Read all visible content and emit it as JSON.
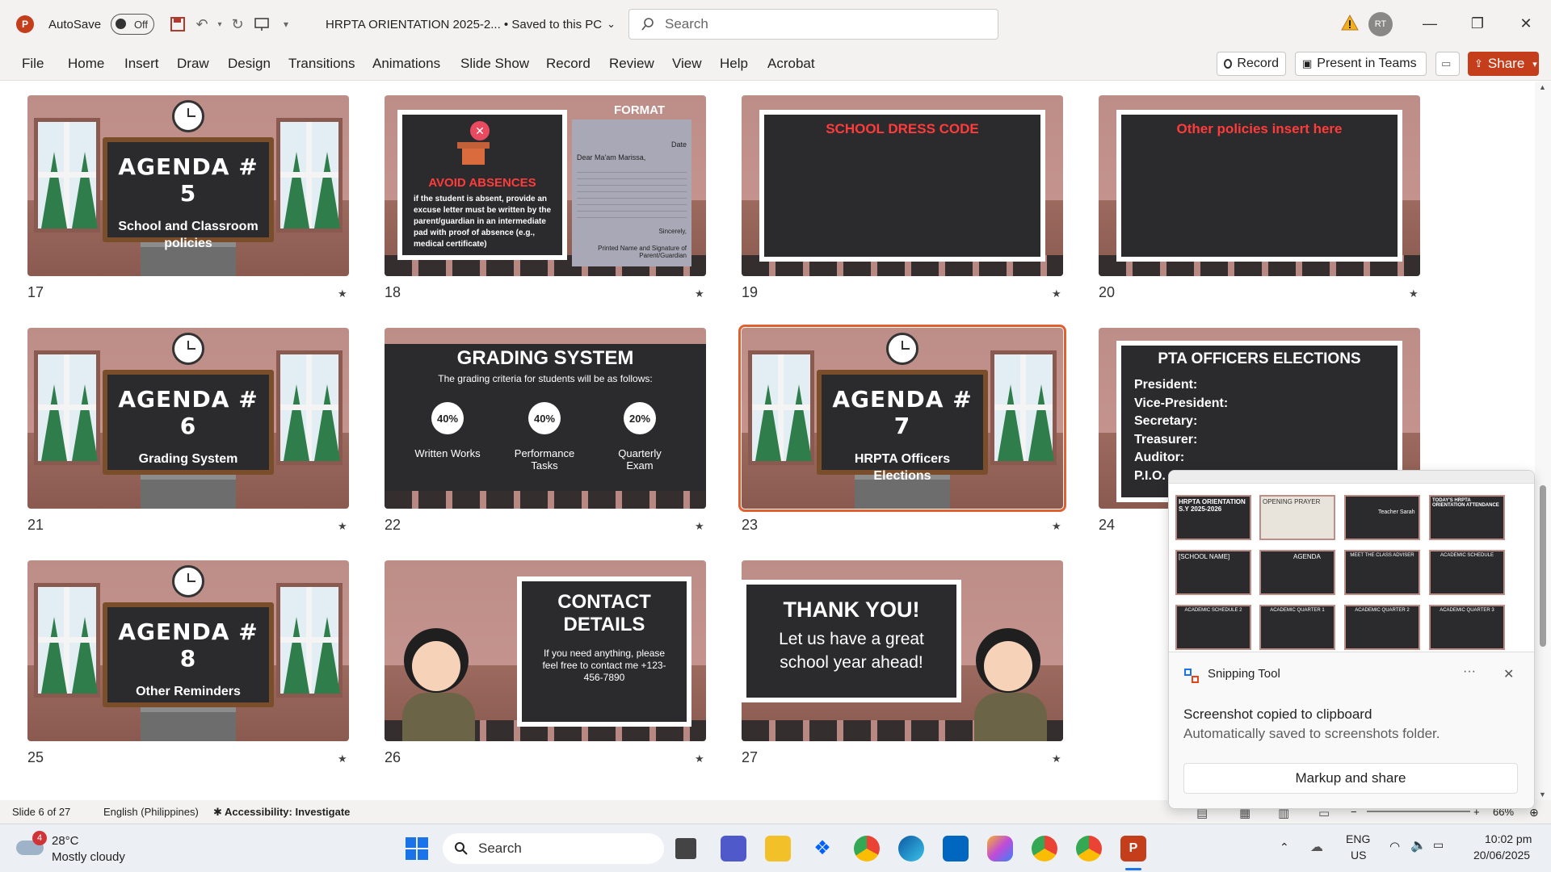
{
  "titlebar": {
    "autosave_label": "AutoSave",
    "autosave_state": "Off",
    "doc_title": "HRPTA ORIENTATION 2025-2... • Saved to this PC",
    "search_placeholder": "Search",
    "avatar_initials": "RT"
  },
  "ribbon": {
    "tabs": [
      "File",
      "Home",
      "Insert",
      "Draw",
      "Design",
      "Transitions",
      "Animations",
      "Slide Show",
      "Record",
      "Review",
      "View",
      "Help",
      "Acrobat"
    ],
    "record_label": "Record",
    "present_label": "Present in Teams",
    "share_label": "Share"
  },
  "slides": [
    {
      "num": "17",
      "heading": "AGENDA # 5",
      "sub": "School and Classroom policies"
    },
    {
      "num": "18",
      "heading": "AVOID ABSENCES",
      "format_label": "FORMAT",
      "letter_date": "Date",
      "letter_greeting": "Dear Ma'am Marissa,",
      "letter_sign": "Sincerely,",
      "letter_footer": "Printed Name and Signature of Parent/Guardian",
      "body": "if the student is absent, provide an excuse letter must be written by the parent/guardian in an intermediate pad with proof of absence (e.g., medical certificate)"
    },
    {
      "num": "19",
      "heading": "SCHOOL DRESS CODE"
    },
    {
      "num": "20",
      "heading": "Other policies insert here"
    },
    {
      "num": "21",
      "heading": "AGENDA # 6",
      "sub": "Grading System"
    },
    {
      "num": "22",
      "heading": "GRADING SYSTEM",
      "sub": "The grading criteria for students will be as follows:",
      "items": [
        {
          "pct": "40%",
          "label": "Written Works"
        },
        {
          "pct": "40%",
          "label": "Performance Tasks"
        },
        {
          "pct": "20%",
          "label": "Quarterly Exam"
        }
      ]
    },
    {
      "num": "23",
      "heading": "AGENDA # 7",
      "sub": "HRPTA Officers Elections"
    },
    {
      "num": "24",
      "heading": "PTA OFFICERS ELECTIONS",
      "roles": [
        "President:",
        "Vice-President:",
        "Secretary:",
        "Treasurer:",
        "Auditor:",
        "P.I.O."
      ]
    },
    {
      "num": "25",
      "heading": "AGENDA # 8",
      "sub": "Other Reminders"
    },
    {
      "num": "26",
      "heading": "CONTACT DETAILS",
      "sub": "If you need anything, please feel free to contact me +123-456-7890"
    },
    {
      "num": "27",
      "heading": "THANK YOU!",
      "sub": "Let us have a great school year ahead!"
    }
  ],
  "statusbar": {
    "slide_count": "Slide 6 of 27",
    "language": "English (Philippines)",
    "accessibility": "Accessibility: Investigate",
    "zoom": "66%"
  },
  "snip": {
    "app_name": "Snipping Tool",
    "msg1": "Screenshot copied to clipboard",
    "msg2": "Automatically saved to screenshots folder.",
    "button": "Markup and share",
    "thumbs": [
      "HRPTA ORIENTATION S.Y 2025-2026",
      "OPENING PRAYER",
      "Teacher Sarah",
      "TODAY'S HRPTA ORIENTATION ATTENDANCE",
      "[SCHOOL NAME]",
      "AGENDA",
      "MEET THE CLASS ADVISER",
      "ACADEMIC SCHEDULE",
      "ACADEMIC SCHEDULE 2",
      "ACADEMIC QUARTER 1",
      "ACADEMIC QUARTER 2",
      "ACADEMIC QUARTER 3"
    ]
  },
  "taskbar": {
    "weather_temp": "28°C",
    "weather_desc": "Mostly cloudy",
    "weather_badge": "4",
    "search_label": "Search",
    "lang_top": "ENG",
    "lang_bottom": "US",
    "time": "10:02 pm",
    "date": "20/06/2025"
  },
  "colors": {
    "accent": "#c43e1c",
    "selected_outline": "#e0612f",
    "board": "#2b2b2d",
    "wall": "#bd8d88"
  }
}
